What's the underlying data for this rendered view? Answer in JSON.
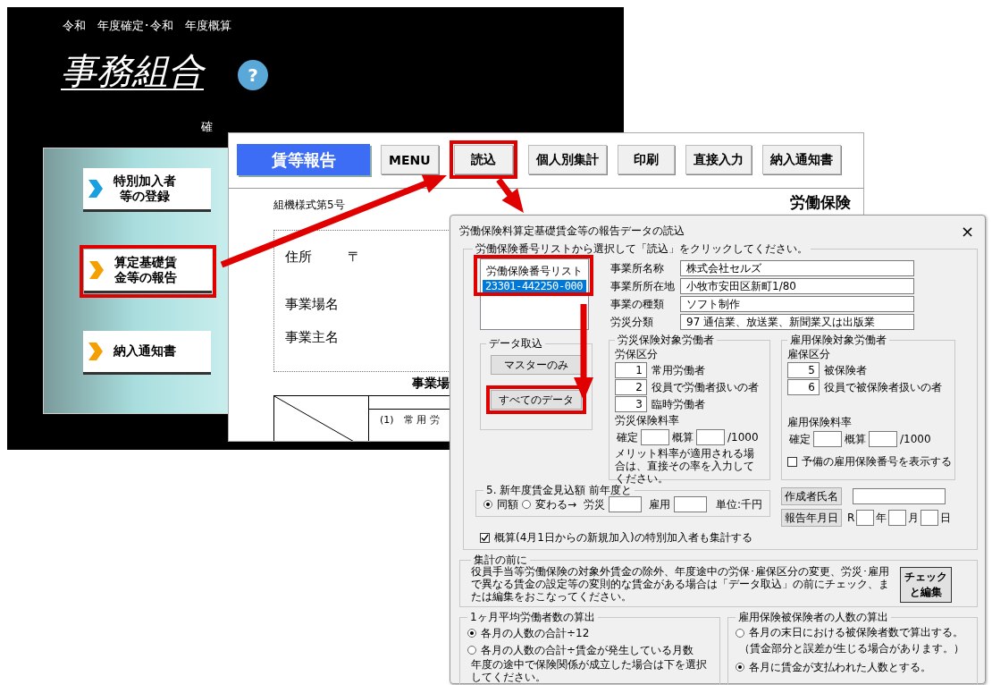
{
  "back_window": {
    "subtitle": "令和　年度確定･令和　年度概算",
    "title": "事務組合",
    "help": "?",
    "partial_label": "確",
    "menu": [
      {
        "lines": [
          "特別加入者",
          "等の登録"
        ],
        "color": "#1aa0e0",
        "highlighted": false
      },
      {
        "lines": [
          "算定基礎賃",
          "金等の報告"
        ],
        "color": "#f5a000",
        "highlighted": true
      },
      {
        "lines": [
          "納入通知書"
        ],
        "color": "#f5a000",
        "highlighted": false
      }
    ]
  },
  "form_window": {
    "title_label": "賃等報告",
    "toolbar": [
      {
        "label": "MENU",
        "highlighted": false
      },
      {
        "label": "読込",
        "highlighted": true
      },
      {
        "label": "個人別集計",
        "highlighted": false
      },
      {
        "label": "印刷",
        "highlighted": false
      },
      {
        "label": "直接入力",
        "highlighted": false
      },
      {
        "label": "納入通知書",
        "highlighted": false
      }
    ],
    "form_number": "組機様式第5号",
    "heading": "労働保険",
    "address_label": "住所",
    "postal_mark": "〒",
    "office_name_label": "事業場名",
    "owner_label": "事業主名",
    "section_label": "事業場",
    "row_label": "(1)　常 用 労"
  },
  "dialog": {
    "title": "労働保険料算定基礎賃金等の報告データの読込",
    "close": "×",
    "main_group": {
      "legend": "労働保険番号リストから選択して「読込」をクリックしてください。",
      "list": {
        "header": "労働保険番号リスト",
        "highlighted": true,
        "items": [
          {
            "label": "23301-442250-000",
            "selected": true
          }
        ]
      },
      "office_fields": [
        {
          "label": "事業所名称",
          "value": "株式会社セルズ"
        },
        {
          "label": "事業所所在地",
          "value": "小牧市安田区新町1/80"
        },
        {
          "label": "事業の種類",
          "value": "ソフト制作"
        },
        {
          "label": "労災分類",
          "value": "97 通信業、放送業、新聞業又は出版業"
        }
      ],
      "import_group": {
        "legend": "データ取込",
        "buttons": [
          {
            "label": "マスターのみ",
            "highlighted": false
          },
          {
            "label": "すべてのデータ",
            "highlighted": true
          }
        ]
      },
      "rousai_group": {
        "legend": "労災保険対象労働者",
        "category_label": "労保区分",
        "categories": [
          {
            "code": "1",
            "label": "常用労働者"
          },
          {
            "code": "2",
            "label": "役員で労働者扱いの者"
          },
          {
            "code": "3",
            "label": "臨時労働者"
          }
        ],
        "rate_label": "労災保険料率",
        "rate_fields": [
          "確定",
          "概算"
        ],
        "rate_unit": "/1000",
        "note": "メリット料率が適用される場合は、直接その率を入力してください。"
      },
      "koyou_group": {
        "legend": "雇用保険対象労働者",
        "category_label": "雇保区分",
        "categories": [
          {
            "code": "5",
            "label": "被保険者"
          },
          {
            "code": "6",
            "label": "役員で被保険者扱いの者"
          }
        ],
        "rate_label": "雇用保険料率",
        "rate_fields": [
          "確定",
          "概算"
        ],
        "rate_unit": "/1000",
        "spare_checkbox": {
          "label": "予備の雇用保険番号を表示する",
          "checked": false
        }
      },
      "estimate_group": {
        "legend": "5. 新年度賃金見込額 前年度と",
        "options": [
          {
            "label": "同額",
            "selected": true
          },
          {
            "label": "変わる→",
            "selected": false
          }
        ],
        "fields": [
          "労災",
          "雇用"
        ],
        "unit": "単位:千円"
      },
      "author_button": "作成者氏名",
      "date_button": "報告年月日",
      "era": "R",
      "date_units": [
        "年",
        "月",
        "日"
      ],
      "include_checkbox": {
        "label": "概算(4月1日からの新規加入)の特別加入者も集計する",
        "checked": true
      }
    },
    "before_group": {
      "legend": "集計の前に",
      "text": "役員手当等労働保険の対象外賃金の除外、年度途中の労保･雇保区分の変更、労災･雇用で異なる賃金の設定等の変則的な賃金がある場合は「データ取込」の前にチェック、または編集をおこなってください。",
      "button_lines": [
        "チェック",
        "と編集"
      ]
    },
    "avg_group": {
      "legend": "1ヶ月平均労働者数の算出",
      "options": [
        {
          "label": "各月の人数の合計÷12",
          "selected": true
        },
        {
          "label": "各月の人数の合計÷賃金が発生している月数",
          "selected": false
        }
      ],
      "note": "年度の途中で保険関係が成立した場合は下を選択してください。"
    },
    "insured_group": {
      "legend": "雇用保険被保険者の人数の算出",
      "options": [
        {
          "label": "各月の末日における被保険者数で算出する。",
          "selected": false,
          "note": "（賃金部分と誤差が生じる場合があります。）"
        },
        {
          "label": "各月に賃金が支払われた人数とする。",
          "selected": true
        }
      ]
    }
  }
}
